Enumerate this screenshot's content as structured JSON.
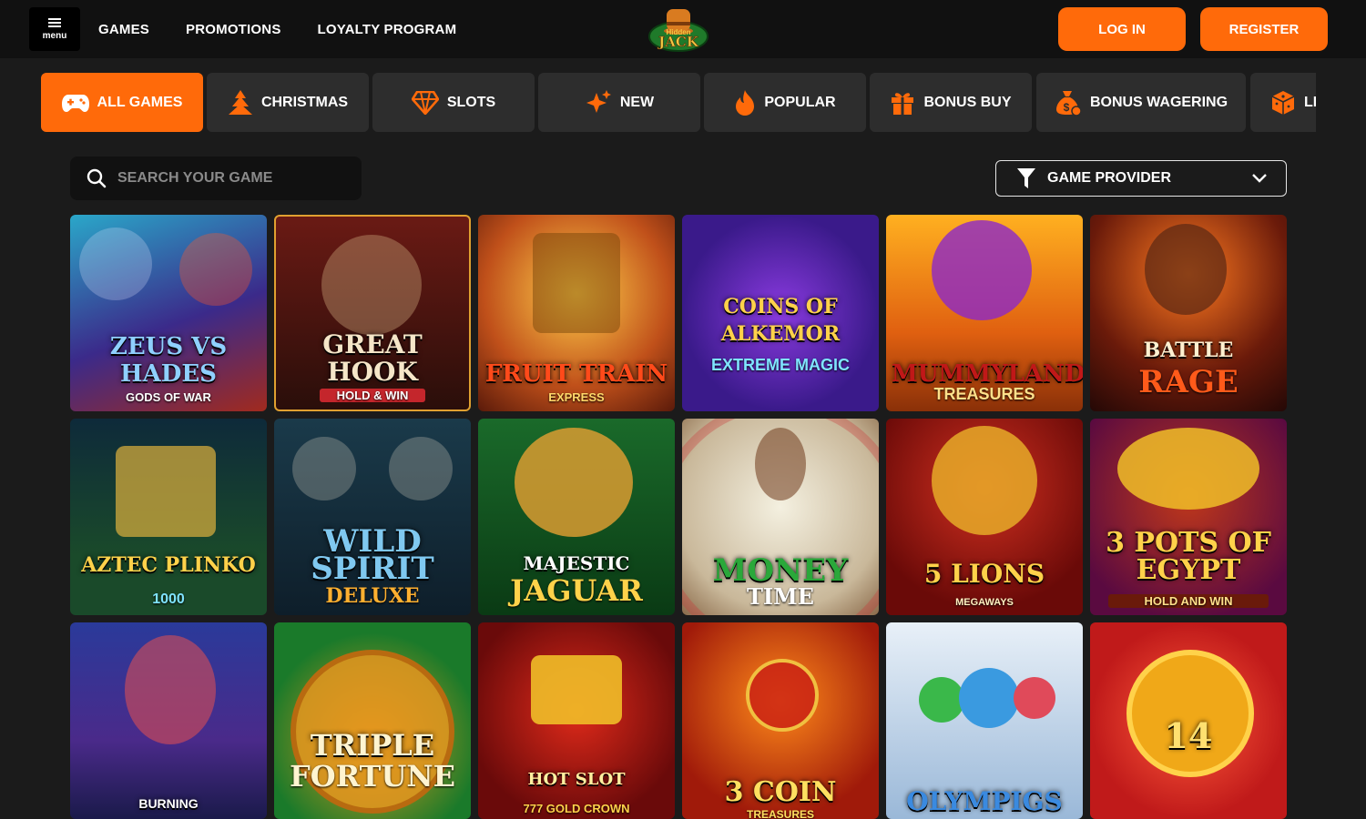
{
  "header": {
    "menu_label": "menu",
    "nav": [
      "GAMES",
      "PROMOTIONS",
      "LOYALTY PROGRAM"
    ],
    "logo_text": "Hidden Jack",
    "login_label": "LOG IN",
    "register_label": "REGISTER"
  },
  "categories": [
    {
      "label": "ALL GAMES",
      "icon": "gamepad-icon",
      "active": true
    },
    {
      "label": "CHRISTMAS",
      "icon": "tree-icon"
    },
    {
      "label": "SLOTS",
      "icon": "diamond-icon"
    },
    {
      "label": "NEW",
      "icon": "sparkle-icon"
    },
    {
      "label": "POPULAR",
      "icon": "flame-icon"
    },
    {
      "label": "BONUS BUY",
      "icon": "gift-icon"
    },
    {
      "label": "BONUS WAGERING",
      "icon": "money-bag-icon"
    },
    {
      "label": "LI",
      "icon": "dice-icon"
    }
  ],
  "search": {
    "placeholder": "SEARCH YOUR GAME"
  },
  "provider": {
    "label": "GAME PROVIDER"
  },
  "games": [
    {
      "title": "ZEUS VS HADES",
      "subtitle": "GODS OF WAR"
    },
    {
      "title": "GREAT HOOK",
      "subtitle": "HOLD & WIN"
    },
    {
      "title": "FRUIT TRAIN",
      "subtitle": "EXPRESS"
    },
    {
      "title": "COINS OF ALKEMOR",
      "subtitle": "EXTREME MAGIC"
    },
    {
      "title": "MUMMYLAND",
      "subtitle": "TREASURES"
    },
    {
      "title": "BATTLE",
      "subtitle": "RAGE"
    },
    {
      "title": "AZTEC PLINKO",
      "subtitle": "1000"
    },
    {
      "title": "WILD SPIRIT",
      "subtitle": "DELUXE"
    },
    {
      "title": "MAJESTIC",
      "subtitle": "JAGUAR"
    },
    {
      "title": "MONEY",
      "subtitle": "TIME"
    },
    {
      "title": "5 LIONS",
      "subtitle": "MEGAWAYS"
    },
    {
      "title": "3 POTS OF EGYPT",
      "subtitle": "HOLD AND WIN"
    },
    {
      "title": "BURNING",
      "subtitle": ""
    },
    {
      "title": "TRIPLE",
      "subtitle": "FORTUNE"
    },
    {
      "title": "HOT SLOT",
      "subtitle": "777 GOLD CROWN"
    },
    {
      "title": "3 COIN",
      "subtitle": "TREASURES"
    },
    {
      "title": "OLYMPIGS",
      "subtitle": ""
    },
    {
      "title": "14",
      "subtitle": ""
    }
  ],
  "colors": {
    "accent": "#ff6a0a",
    "background": "#1b1b1b",
    "header": "#111111",
    "tile": "#2d2d2d"
  }
}
